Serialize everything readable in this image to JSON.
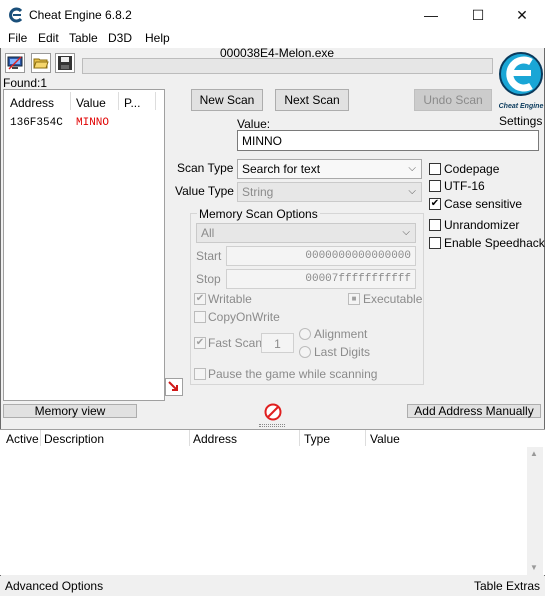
{
  "title": "Cheat Engine 6.8.2",
  "window_controls": {
    "minimize": "—",
    "maximize": "☐",
    "close": "✕"
  },
  "menu": [
    "File",
    "Edit",
    "Table",
    "D3D",
    "Help"
  ],
  "process": "000038E4-Melon.exe",
  "found_label": "Found:",
  "found_count": "1",
  "results": {
    "headers": [
      "Address",
      "Value",
      "P..."
    ],
    "rows": [
      {
        "address": "136F354C",
        "value": "MINNO"
      }
    ]
  },
  "buttons": {
    "new_scan": "New Scan",
    "next_scan": "Next Scan",
    "undo_scan": "Undo Scan",
    "memory_view": "Memory view",
    "add_address": "Add Address Manually"
  },
  "logo_text": "Cheat Engine",
  "settings": "Settings",
  "value_label": "Value:",
  "value": "MINNO",
  "scan_type": {
    "label": "Scan Type",
    "selected": "Search for text"
  },
  "value_type": {
    "label": "Value Type",
    "selected": "String"
  },
  "options": {
    "codepage": "Codepage",
    "utf16": "UTF-16",
    "case_sensitive": "Case sensitive",
    "unrandomizer": "Unrandomizer",
    "speedhack": "Enable Speedhack"
  },
  "memory_scan": {
    "title": "Memory Scan Options",
    "region": "All",
    "start_label": "Start",
    "start": "0000000000000000",
    "stop_label": "Stop",
    "stop": "00007fffffffffff",
    "writable": "Writable",
    "executable": "Executable",
    "copy_on_write": "CopyOnWrite",
    "fast_scan": "Fast Scan",
    "fast_scan_value": "1",
    "alignment": "Alignment",
    "last_digits": "Last Digits",
    "pause": "Pause the game while scanning"
  },
  "table_headers": [
    "Active",
    "Description",
    "Address",
    "Type",
    "Value"
  ],
  "status": {
    "left": "Advanced Options",
    "right": "Table Extras"
  },
  "colors": {
    "result_value": "#e00000",
    "stop_icon": "#e02020",
    "logo": "#1aa6d6"
  }
}
